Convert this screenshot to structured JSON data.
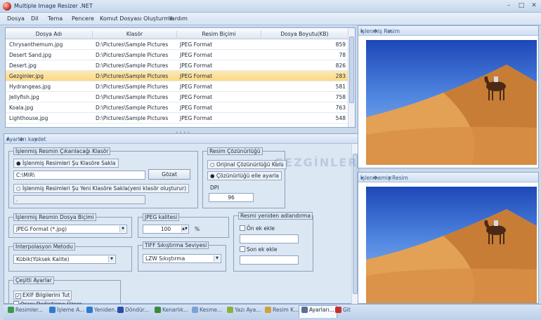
{
  "window": {
    "title": "Multiple Image Resizer .NET",
    "controls": [
      "–",
      "□",
      "✕"
    ]
  },
  "menu": [
    "Dosya",
    "Dil",
    "Tema",
    "Pencere",
    "Komut Dosyası Oluşturma",
    "Yardım"
  ],
  "grid": {
    "columns": [
      "Dosya Adı",
      "Klasör",
      "Resim Biçimi",
      "Dosya Boyutu(KB)"
    ],
    "rows": [
      {
        "name": "Chrysanthemum.jpg",
        "folder": "D:\\Pictures\\Sample Pictures",
        "format": "JPEG Format",
        "size": "859"
      },
      {
        "name": "Desert Sand.jpg",
        "folder": "D:\\Pictures\\Sample Pictures",
        "format": "JPEG Format",
        "size": "78"
      },
      {
        "name": "Desert.jpg",
        "folder": "D:\\Pictures\\Sample Pictures",
        "format": "JPEG Format",
        "size": "826"
      },
      {
        "name": "Gezginler.jpg",
        "folder": "D:\\Pictures\\Sample Pictures",
        "format": "JPEG Format",
        "size": "283"
      },
      {
        "name": "Hydrangeas.jpg",
        "folder": "D:\\Pictures\\Sample Pictures",
        "format": "JPEG Format",
        "size": "581"
      },
      {
        "name": "Jellyfish.jpg",
        "folder": "D:\\Pictures\\Sample Pictures",
        "format": "JPEG Format",
        "size": "758"
      },
      {
        "name": "Koala.jpg",
        "folder": "D:\\Pictures\\Sample Pictures",
        "format": "JPEG Format",
        "size": "763"
      },
      {
        "name": "Lighthouse.jpg",
        "folder": "D:\\Pictures\\Sample Pictures",
        "format": "JPEG Format",
        "size": "548"
      }
    ],
    "selected_row": 3
  },
  "settings": {
    "title": "Ayarları kaydet",
    "panel_buttons": "▾ ✥ ✕",
    "output_folder": {
      "label": "İşlenmiş Resmin Çıkarılacağı Klasör",
      "radio_save": "İşlenmiş Resimleri Şu Klasöre Sakla",
      "path": "C:\\MIR\\",
      "browse": "Gözat",
      "radio_new": "İşlenmiş Resimleri Şu Yeni Klasöre Sakla(yeni klasör oluşturur)",
      "new_path": "."
    },
    "resolution": {
      "label": "Resim Çözünürlüğü",
      "keep": "Orijinal Çözünürlüğü Koru",
      "manual": "Çözünürlüğü elle ayarla",
      "dpi_label": "DPI",
      "dpi": "96"
    },
    "file_format": {
      "label": "İşlenmiş Resmin Dosya Biçimi",
      "value": "JPEG Format (*.jpg)"
    },
    "jpeg_quality": {
      "label": "JPEG kalitesi",
      "value": "100",
      "unit": "%"
    },
    "rename": {
      "label": "Resmi yeniden adlandırma",
      "prefix": "Ön ek ekle",
      "suffix": "Son ek ekle"
    },
    "interpolation": {
      "label": "İnterpolasyon Metodu",
      "value": "Kübik(Yüksek Kalite)"
    },
    "tiff": {
      "label": "TIFF Sıkıştırma Seviyesi",
      "value": "LZW Sıkıştırma"
    },
    "misc": {
      "label": "Çeşitli Ayarlar",
      "exif": "EXIF Bilgilerini Tut",
      "cut_partial": "Oranı Değiştirme Üzere"
    }
  },
  "processed_panel": {
    "title": "İşlenmiş Resim",
    "buttons": "▾ ✥ ✕"
  },
  "original_panel": {
    "title": "İşlenmemiş Resim",
    "buttons": "▾ ✥ ✕"
  },
  "watermark": "GEZGİNLER",
  "tabs": [
    {
      "label": "Resimler...",
      "color": "#3a9a4c"
    },
    {
      "label": "İşleme A...",
      "color": "#2b7bd0"
    },
    {
      "label": "Yeniden...",
      "color": "#2b7bd0"
    },
    {
      "label": "Döndür...",
      "color": "#2b4fa8"
    },
    {
      "label": "Kenarlık...",
      "color": "#3b8a3b"
    },
    {
      "label": "Kesme...",
      "color": "#7aa3d8"
    },
    {
      "label": "Yazı Aya...",
      "color": "#8bb040"
    },
    {
      "label": "Resim K...",
      "color": "#d0a040"
    },
    {
      "label": "Ayarları...",
      "color": "#5a6f91"
    },
    {
      "label": "Git",
      "color": "#c8302a"
    }
  ]
}
